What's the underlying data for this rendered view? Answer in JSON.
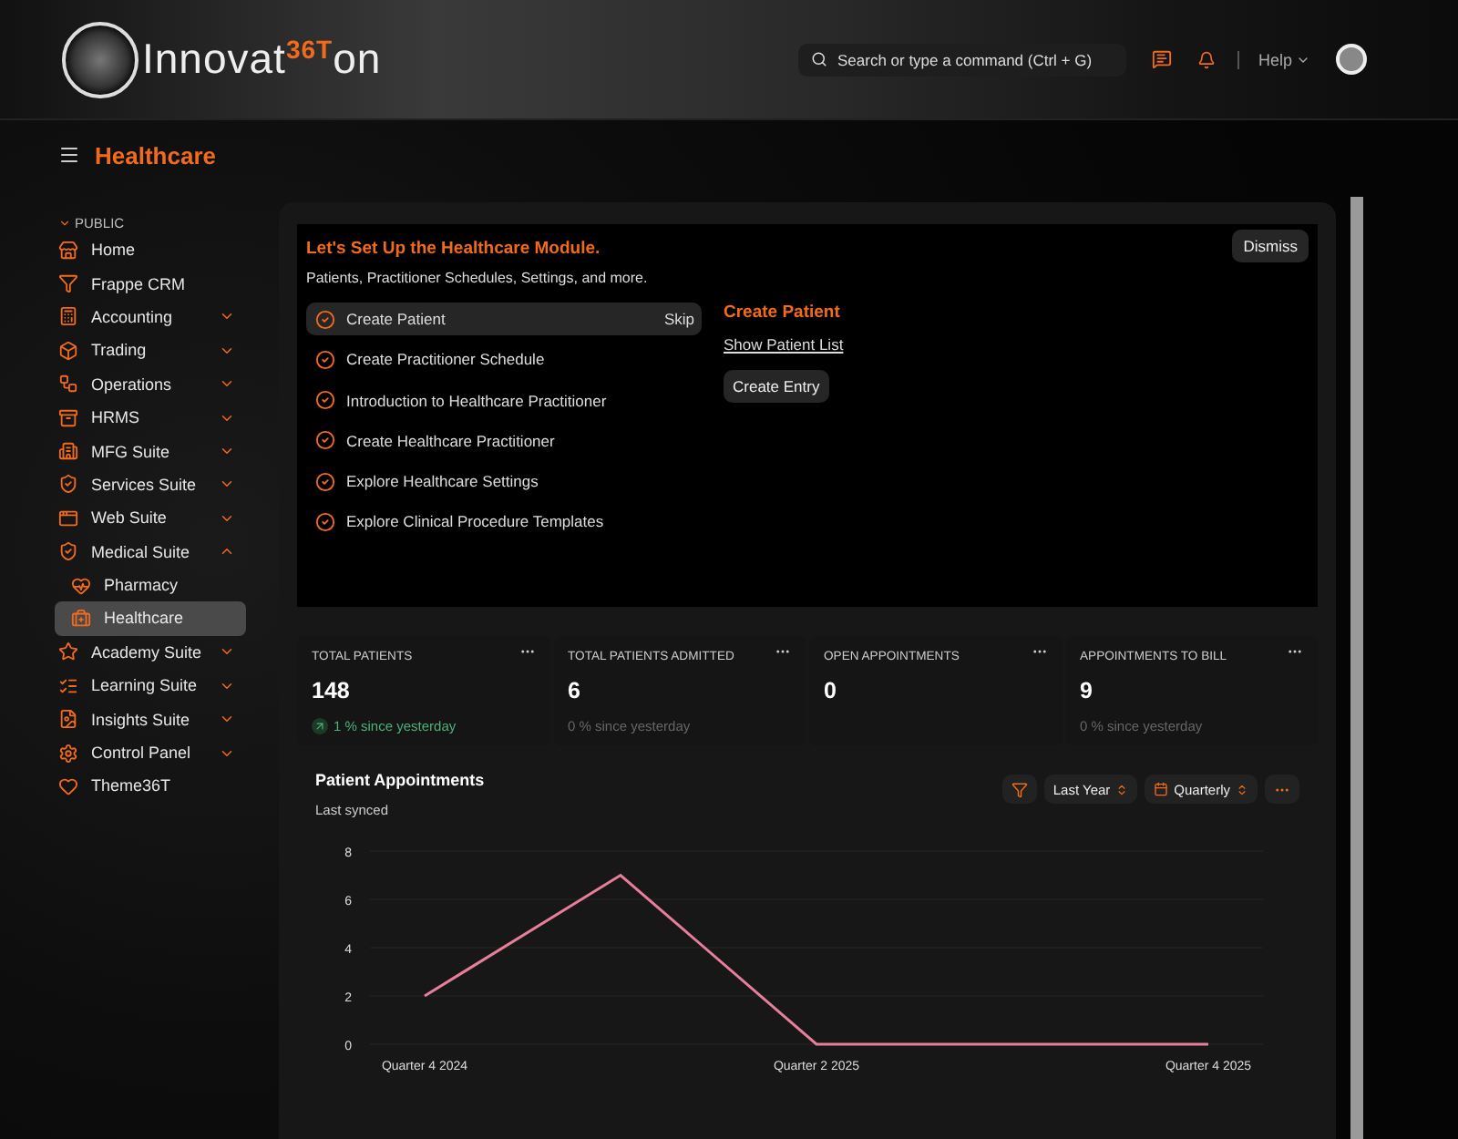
{
  "navbar": {
    "logo_text": "Innovat",
    "logo_sup": "36T",
    "logo_tail": "on",
    "search": {
      "placeholder": "Search or type a command (Ctrl + G)"
    },
    "help": "Help"
  },
  "page_title": "Healthcare",
  "sidebar": {
    "section": "PUBLIC",
    "items": [
      {
        "label": "Home",
        "selected": false
      },
      {
        "label": "Frappe CRM",
        "selected": false
      },
      {
        "label": "Accounting",
        "selected": false,
        "expanded": false
      },
      {
        "label": "Trading",
        "selected": false,
        "expanded": false
      },
      {
        "label": "Operations",
        "selected": false,
        "expanded": false
      },
      {
        "label": "HRMS",
        "selected": false,
        "expanded": false
      },
      {
        "label": "MFG Suite",
        "selected": false,
        "expanded": false
      },
      {
        "label": "Services Suite",
        "selected": false,
        "expanded": false
      },
      {
        "label": "Web Suite",
        "selected": false,
        "expanded": false
      },
      {
        "label": "Medical Suite",
        "selected": false,
        "expanded": true,
        "children": [
          {
            "label": "Pharmacy",
            "selected": false
          },
          {
            "label": "Healthcare",
            "selected": true
          }
        ]
      },
      {
        "label": "Academy Suite",
        "selected": false,
        "expanded": false
      },
      {
        "label": "Learning Suite",
        "selected": false,
        "expanded": false
      },
      {
        "label": "Insights Suite",
        "selected": false,
        "expanded": false
      },
      {
        "label": "Control Panel",
        "selected": false,
        "expanded": false
      },
      {
        "label": "Theme36T",
        "selected": false
      }
    ]
  },
  "onboarding": {
    "title": "Let's Set Up the Healthcare Module.",
    "subtitle": "Patients, Practitioner Schedules, Settings, and more.",
    "dismiss": "Dismiss",
    "skip": "Skip",
    "steps": [
      {
        "label": "Create Patient",
        "selected": true
      },
      {
        "label": "Create Practitioner Schedule",
        "selected": false
      },
      {
        "label": "Introduction to Healthcare Practitioner",
        "selected": false
      },
      {
        "label": "Create Healthcare Practitioner",
        "selected": false
      },
      {
        "label": "Explore Healthcare Settings",
        "selected": false
      },
      {
        "label": "Explore Clinical Procedure Templates",
        "selected": false
      }
    ],
    "detail": {
      "title": "Create Patient",
      "link": "Show Patient List",
      "button": "Create Entry"
    }
  },
  "stats": [
    {
      "label": "TOTAL PATIENTS",
      "value": "148",
      "change": "1 % since yesterday",
      "rising": true
    },
    {
      "label": "TOTAL PATIENTS ADMITTED",
      "value": "6",
      "change": "0 % since yesterday",
      "rising": false
    },
    {
      "label": "OPEN APPOINTMENTS",
      "value": "0"
    },
    {
      "label": "APPOINTMENTS TO BILL",
      "value": "9",
      "change": "0 % since yesterday",
      "rising": false
    }
  ],
  "chart_card": {
    "title": "Patient Appointments",
    "subtitle": "Last synced",
    "range": "Last Year",
    "interval": "Quarterly",
    "chart_data": {
      "type": "line",
      "categories": [
        "Quarter 4 2024",
        null,
        "Quarter 2 2025",
        null,
        "Quarter 4 2025"
      ],
      "series": [
        {
          "color": "#e87f9a",
          "values": [
            2,
            7,
            0,
            0,
            0
          ]
        }
      ],
      "ylim": [
        0,
        8
      ],
      "yticks": [
        0,
        2,
        4,
        6,
        8
      ],
      "grid": true
    }
  }
}
